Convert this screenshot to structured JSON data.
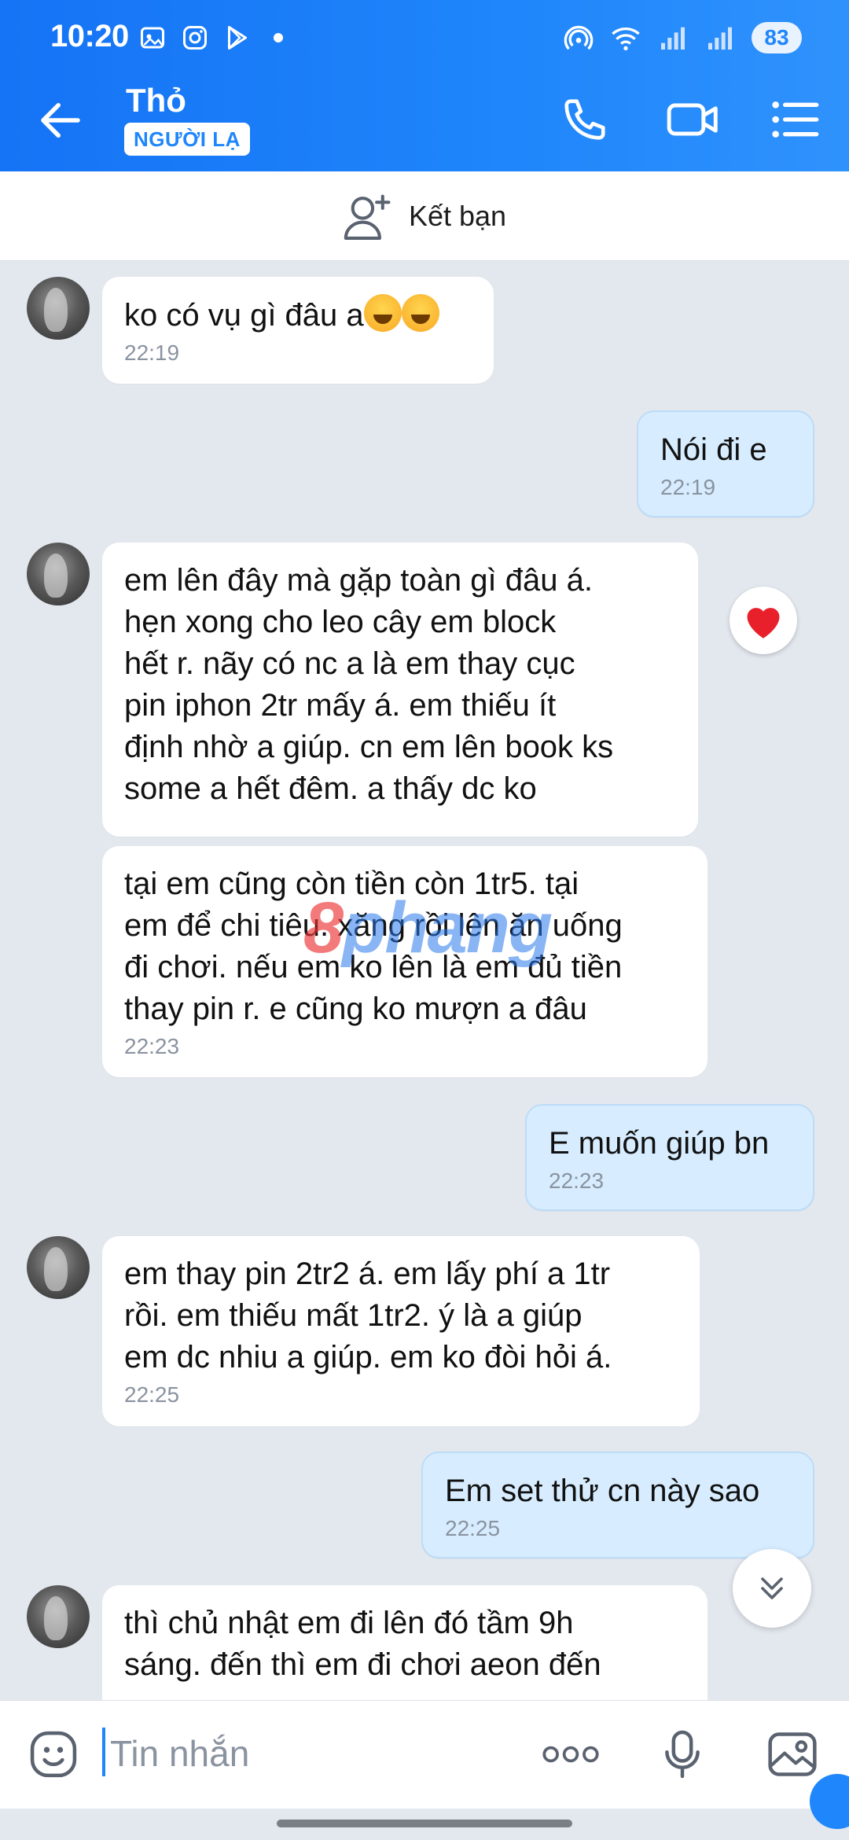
{
  "status_bar": {
    "time": "10:20",
    "battery": "83",
    "left_icons": [
      "photo-notification-icon",
      "instagram-icon",
      "play-store-icon"
    ],
    "right_icons": [
      "hotspot-icon",
      "wifi-icon",
      "signal-icon",
      "signal-icon"
    ]
  },
  "header": {
    "name": "Thỏ",
    "badge": "NGƯỜI LẠ",
    "accent": "#1f86fb"
  },
  "add_friend": {
    "label": "Kết bạn"
  },
  "messages": [
    {
      "from": "them",
      "text": "ko có vụ gì đâu a",
      "emoji_count": 2,
      "time": "22:19"
    },
    {
      "from": "me",
      "text": "Nói đi e",
      "time": "22:19"
    },
    {
      "from": "them",
      "text": "em lên đây mà gặp toàn gì đâu á.\nhẹn xong cho leo cây em block\nhết r.  nãy có nc a là em thay cục\npin iphon 2tr mấy á. em thiếu ít\nđịnh nhờ a giúp. cn em lên book ks\nsome a hết đêm. a thấy dc ko",
      "time": "",
      "reaction": "heart"
    },
    {
      "from": "them",
      "text": "tại em cũng còn tiền còn 1tr5. tại\nem để chi tiêu. xăng rồi lên ăn uống\nđi chơi. nếu em ko lên là em đủ tiền\nthay pin r. e cũng ko mượn a đâu",
      "time": "22:23"
    },
    {
      "from": "me",
      "text": "E muốn giúp bn",
      "time": "22:23"
    },
    {
      "from": "them",
      "text": "em thay pin 2tr2 á. em  lấy phí a 1tr\nrồi. em thiếu mất 1tr2. ý là a giúp\nem dc nhiu a giúp. em ko đòi hỏi á.",
      "time": "22:25"
    },
    {
      "from": "me",
      "text": "Em set thử cn này sao",
      "time": "22:25"
    },
    {
      "from": "them",
      "text": "thì chủ nhật em đi lên đó tầm 9h\nsáng. đến thì em đi chơi aeon đến",
      "time": ""
    }
  ],
  "watermark": {
    "part1": "8",
    "part2": "phang"
  },
  "composer": {
    "placeholder": "Tin nhắn"
  }
}
